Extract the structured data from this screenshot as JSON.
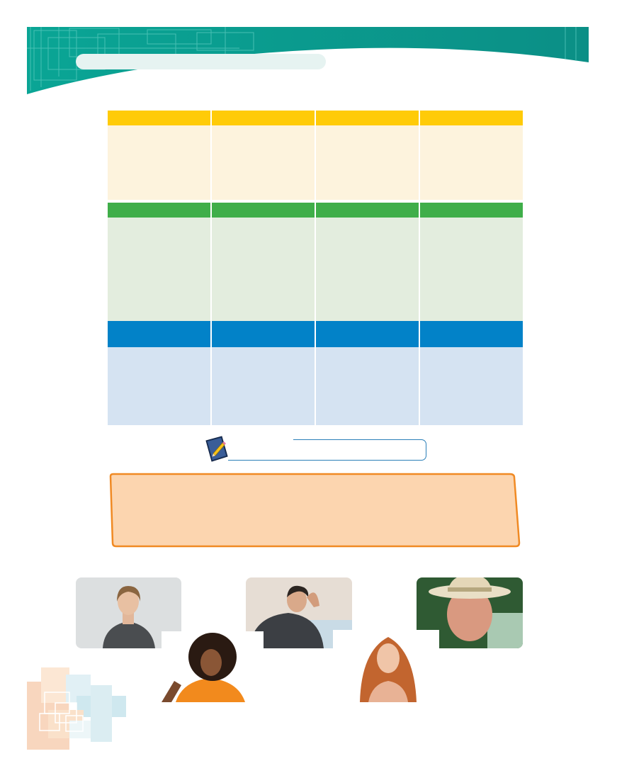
{
  "header": {
    "title": ""
  },
  "table": {
    "yellow_headers": [
      "",
      "",
      "",
      ""
    ],
    "yellow_cells": [
      "",
      "",
      "",
      ""
    ],
    "green_headers": [
      "",
      "",
      "",
      ""
    ],
    "green_cells": [
      "",
      "",
      "",
      ""
    ],
    "blue_headers": [
      "",
      "",
      "",
      ""
    ],
    "blue_cells": [
      "",
      "",
      "",
      ""
    ]
  },
  "writing_prompt": {
    "text": ""
  },
  "note": {
    "text": ""
  },
  "colors": {
    "banner_teal": "#0aa595",
    "yellow_header": "#ffcb08",
    "yellow_body": "#fdf3dd",
    "green_header": "#3fae49",
    "green_body": "#e3edde",
    "blue_header": "#0282c8",
    "blue_body": "#d5e3f2",
    "note_fill": "#fcd5af",
    "note_border": "#f08a24"
  },
  "icons": [
    "pencil-book-icon"
  ],
  "photos": [
    "young-woman-grey-tshirt",
    "man-hand-on-head",
    "elderly-man-straw-hat",
    "woman-orange-top-curly-hair",
    "red-haired-woman"
  ]
}
